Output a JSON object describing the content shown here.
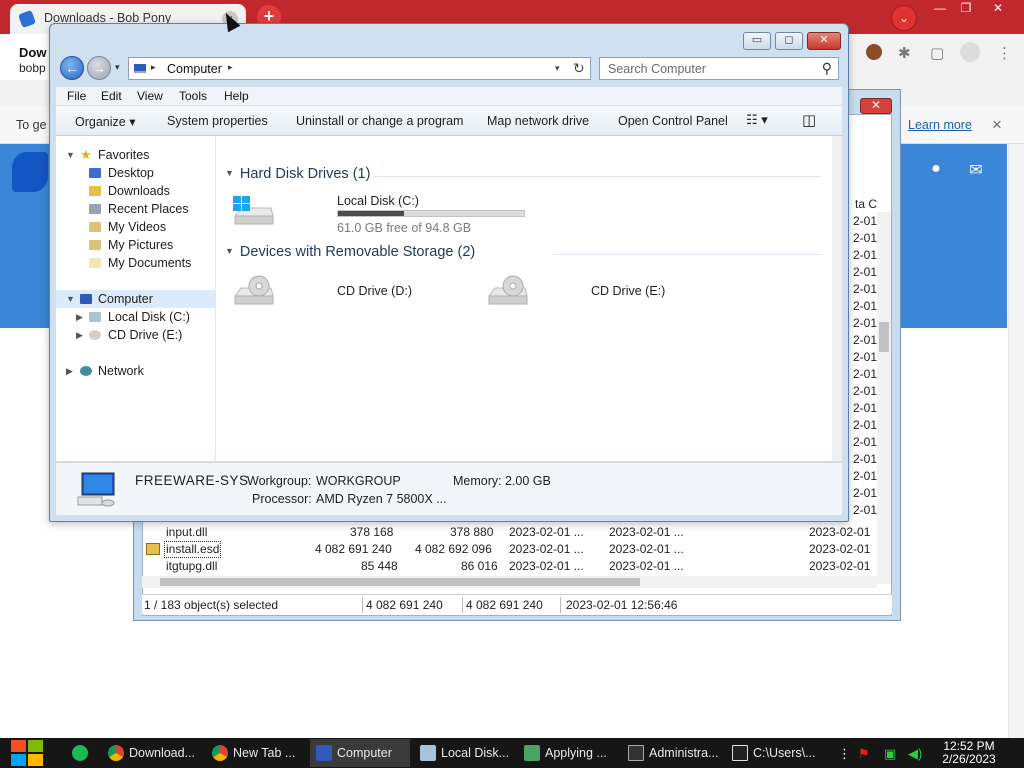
{
  "browser": {
    "tab_title": "Downloads - Bob Pony",
    "downloads_title": "Dow",
    "downloads_sub": "bobp",
    "infobar_text": "To ge",
    "learn_more": "Learn more",
    "new_tab": "+",
    "close_glyph": "×",
    "dropdown_glyph": "⌄",
    "win_min": "—",
    "win_max": "❐",
    "win_close": "✕"
  },
  "zip": {
    "close_glyph": "✕",
    "right_header": "ta C",
    "right_values": [
      "2-01",
      "2-01",
      "2-01",
      "2-01",
      "2-01",
      "2-01",
      "2-01",
      "2-01",
      "2-01",
      "2-01",
      "2-01",
      "2-01",
      "2-01",
      "2-01",
      "2-01",
      "2-01",
      "2-01",
      "2-01"
    ],
    "rows": [
      {
        "name": "input.dll",
        "size": "378 168",
        "packed": "378 880",
        "modified": "2023-02-01 ...",
        "created": "2023-02-01 ...",
        "accessed": "2023-02-01"
      },
      {
        "name": "install.esd",
        "size": "4 082 691 240",
        "packed": "4 082 692 096",
        "modified": "2023-02-01 ...",
        "created": "2023-02-01 ...",
        "accessed": "2023-02-01"
      },
      {
        "name": "itgtupg.dll",
        "size": "85 448",
        "packed": "86 016",
        "modified": "2023-02-01 ...",
        "created": "2023-02-01 ...",
        "accessed": "2023-02-01"
      }
    ],
    "status": {
      "selected": "1 / 183 object(s) selected",
      "size": "4 082 691 240",
      "packed": "4 082 691 240",
      "date": "2023-02-01 12:56:46"
    }
  },
  "explorer": {
    "window_buttons": {
      "minimize": "▭",
      "maximize": "◻",
      "close": "✕"
    },
    "nav": {
      "back": "←",
      "forward": "→",
      "dropdown": "▾"
    },
    "address": {
      "path": "Computer",
      "sep": "▸",
      "dropdown": "▾",
      "refresh": "↻"
    },
    "search_placeholder": "Search Computer",
    "search_glyph": "⚲",
    "menu": [
      "File",
      "Edit",
      "View",
      "Tools",
      "Help"
    ],
    "toolbar": {
      "organize": "Organize ▾",
      "system_properties": "System properties",
      "uninstall": "Uninstall or change a program",
      "map_drive": "Map network drive",
      "control_panel": "Open Control Panel",
      "views_glyph": "☷ ▾",
      "preview_glyph": "◫"
    },
    "nav_pane": {
      "favorites": "Favorites",
      "favorites_items": [
        "Desktop",
        "Downloads",
        "Recent Places",
        "My Videos",
        "My Pictures",
        "My Documents"
      ],
      "computer": "Computer",
      "computer_items": [
        "Local Disk (C:)",
        "CD Drive (E:)"
      ],
      "network": "Network"
    },
    "groups": {
      "hdd_title": "Hard Disk Drives (1)",
      "removable_title": "Devices with Removable Storage (2)"
    },
    "drives": {
      "c_name": "Local Disk (C:)",
      "c_free": "61.0 GB free of 94.8 GB",
      "c_used_fraction": 0.357,
      "d_name": "CD Drive (D:)",
      "e_name": "CD Drive (E:)"
    },
    "details": {
      "computer_name": "FREEWARE-SYS",
      "workgroup_label": "Workgroup:",
      "workgroup_value": "WORKGROUP",
      "memory_label": "Memory:",
      "memory_value": "2.00 GB",
      "processor_label": "Processor:",
      "processor_value": "AMD Ryzen 7 5800X ..."
    }
  },
  "taskbar": {
    "items": [
      "Download...",
      "New Tab ...",
      "Computer",
      "Local Disk...",
      "Applying ...",
      "Administra...",
      "C:\\Users\\..."
    ],
    "time": "12:52 PM",
    "date": "2/26/2023",
    "more_glyph": "⋮"
  }
}
